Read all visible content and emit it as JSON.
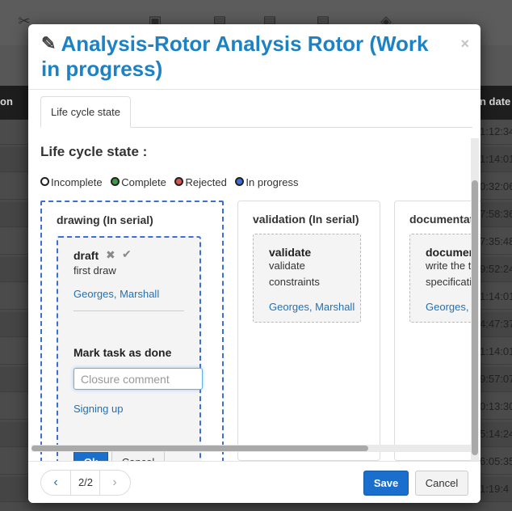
{
  "background": {
    "toolbar_icons": [
      "tools-icon",
      "trash-icon",
      "document-check-icon",
      "document-export-icon",
      "document-import-icon",
      "package-icon"
    ],
    "header": {
      "left": "on",
      "right": "n date"
    },
    "row_times": [
      "1:12:34",
      "1:14:01",
      "0:32:06",
      "7:58:36",
      "7:35:48",
      "9:52:24",
      "1:14:01",
      "4:47:37",
      "1:14:01",
      "9:57:07",
      "0:13:30",
      "5:14:24",
      "6:05:35",
      "1:19:4"
    ]
  },
  "modal": {
    "title": "Analysis-Rotor Analysis Rotor (Work in progress)",
    "close_glyph": "×",
    "tab_label": "Life cycle state",
    "section_title": "Life cycle state :",
    "legend": [
      {
        "label": "Incomplete",
        "color": "#ffffff"
      },
      {
        "label": "Complete",
        "color": "#3d9b48"
      },
      {
        "label": "Rejected",
        "color": "#d9534f"
      },
      {
        "label": "In progress",
        "color": "#3b6fd4"
      }
    ],
    "columns": [
      {
        "title": "drawing (In serial)",
        "task": {
          "name": "draft",
          "desc": [
            "first draw"
          ],
          "assignees": "Georges, Marshall",
          "mark_title": "Mark task as done",
          "closure_placeholder": "Closure comment",
          "signing_link": "Signing up",
          "ok_label": "Ok",
          "cancel_label": "Cancel"
        }
      },
      {
        "title": "validation (In serial)",
        "task": {
          "name": "validate",
          "desc": [
            "validate",
            "constraints"
          ],
          "assignees": "Georges, Marshall"
        }
      },
      {
        "title": "documentati",
        "task": {
          "name": "documen",
          "desc": [
            "write the t",
            "specificati"
          ],
          "assignees": "Georges,"
        }
      }
    ],
    "footer": {
      "prev_glyph": "‹",
      "next_glyph": "›",
      "page_label": "2/2",
      "save_label": "Save",
      "cancel_label": "Cancel"
    }
  }
}
